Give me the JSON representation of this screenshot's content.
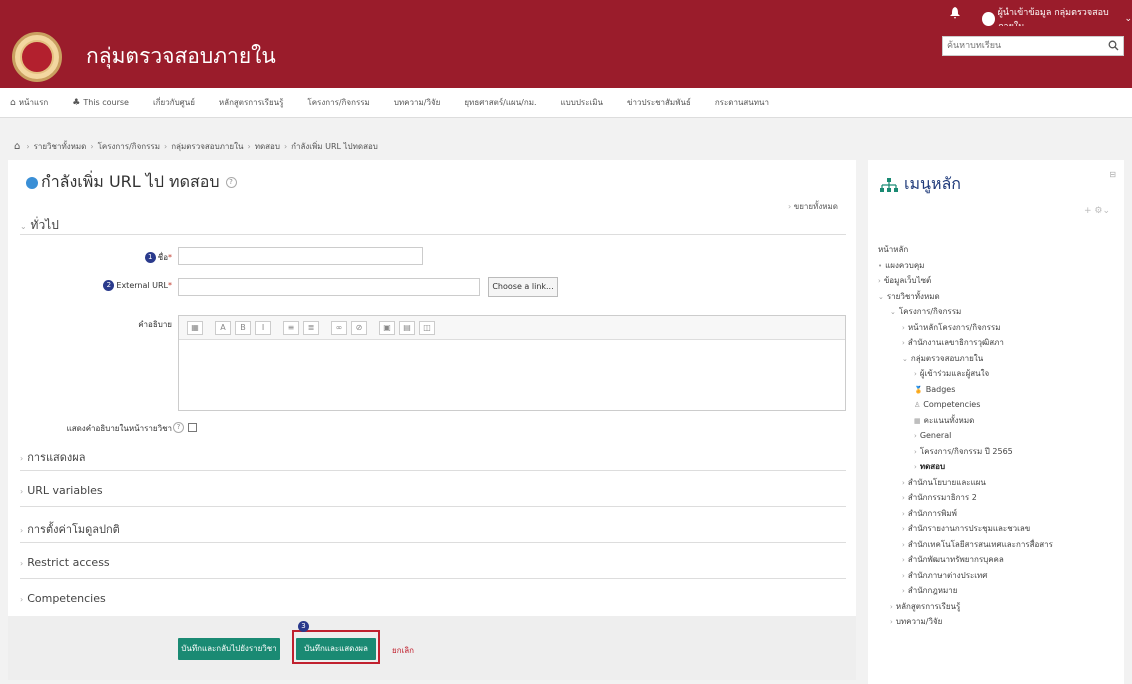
{
  "topbar": {
    "user_name": "ผู้นำเข้าข้อมูล กลุ่มตรวจสอบภายใน"
  },
  "header": {
    "site_title": "กลุ่มตรวจสอบภายใน",
    "search_placeholder": "ค้นหาบทเรียน"
  },
  "nav": {
    "items": [
      {
        "icon": "home-icon",
        "label": "หน้าแรก"
      },
      {
        "icon": "sitemap-icon",
        "label": "This course"
      },
      {
        "label": "เกี่ยวกับศูนย์"
      },
      {
        "label": "หลักสูตรการเรียนรู้"
      },
      {
        "label": "โครงการ/กิจกรรม"
      },
      {
        "label": "บทความ/วิจัย"
      },
      {
        "label": "ยุทธศาสตร์/แผน/กม."
      },
      {
        "label": "แบบประเมิน"
      },
      {
        "label": "ข่าวประชาสัมพันธ์"
      },
      {
        "label": "กระดานสนทนา"
      }
    ]
  },
  "breadcrumb": [
    "รายวิชาทั้งหมด",
    "โครงการ/กิจกรรม",
    "กลุ่มตรวจสอบภายใน",
    "ทดสอบ",
    "กำลังเพิ่ม URL ไปทดสอบ"
  ],
  "main": {
    "page_title": "กำลังเพิ่ม URL ไป ทดสอบ",
    "expand_all": "ขยายทั้งหมด",
    "section_general": "ทั่วไป",
    "name_label": "ชื่อ",
    "name_badge": "1",
    "name_value": "",
    "url_label": "External URL",
    "url_badge": "2",
    "url_value": "",
    "choose_link": "Choose a link...",
    "description_label": "คำอธิบาย",
    "show_desc_label": "แสดงคำอธิบายในหน้ารายวิชา",
    "sections_collapsed": [
      "การแสดงผล",
      "URL variables",
      "การตั้งค่าโมดูลปกติ",
      "Restrict access",
      "Competencies"
    ],
    "btn_save_return": "บันทึกและกลับไปยังรายวิชา",
    "btn_save_display": "บันทึกและแสดงผล",
    "btn_cancel": "ยกเลิก",
    "badge3": "3"
  },
  "block": {
    "title": "เมนูหลัก",
    "tree": [
      {
        "label": "หน้าหลัก",
        "level": 0,
        "arrow": ""
      },
      {
        "label": "แผงควบคุม",
        "level": 0,
        "arrow": "•"
      },
      {
        "label": "ข้อมูลเว็บไซต์",
        "level": 0,
        "arrow": "›"
      },
      {
        "label": "รายวิชาทั้งหมด",
        "level": 0,
        "arrow": "⌄"
      },
      {
        "label": "โครงการ/กิจกรรม",
        "level": 1,
        "arrow": "⌄"
      },
      {
        "label": "หน้าหลักโครงการ/กิจกรรม",
        "level": 2,
        "arrow": "›"
      },
      {
        "label": "สำนักงานเลขาธิการวุฒิสภา",
        "level": 2,
        "arrow": "›"
      },
      {
        "label": "กลุ่มตรวจสอบภายใน",
        "level": 2,
        "arrow": "⌄"
      },
      {
        "label": "ผู้เข้าร่วมและผู้สนใจ",
        "level": 3,
        "arrow": "›"
      },
      {
        "label": "Badges",
        "level": 3,
        "arrow": "🏅"
      },
      {
        "label": "Competencies",
        "level": 3,
        "arrow": "♙"
      },
      {
        "label": "คะแนนทั้งหมด",
        "level": 3,
        "arrow": "▦"
      },
      {
        "label": "General",
        "level": 3,
        "arrow": "›"
      },
      {
        "label": "โครงการ/กิจกรรม ปี 2565",
        "level": 3,
        "arrow": "›"
      },
      {
        "label": "ทดสอบ",
        "level": 3,
        "arrow": "›",
        "bold": true
      },
      {
        "label": "สำนักนโยบายและแผน",
        "level": 2,
        "arrow": "›"
      },
      {
        "label": "สำนักกรรมาธิการ 2",
        "level": 2,
        "arrow": "›"
      },
      {
        "label": "สำนักการพิมพ์",
        "level": 2,
        "arrow": "›"
      },
      {
        "label": "สำนักรายงานการประชุมและชวเลข",
        "level": 2,
        "arrow": "›"
      },
      {
        "label": "สำนักเทคโนโลยีสารสนเทศและการสื่อสาร",
        "level": 2,
        "arrow": "›"
      },
      {
        "label": "สำนักพัฒนาทรัพยากรบุคคล",
        "level": 2,
        "arrow": "›"
      },
      {
        "label": "สำนักภาษาต่างประเทศ",
        "level": 2,
        "arrow": "›"
      },
      {
        "label": "สำนักกฎหมาย",
        "level": 2,
        "arrow": "›"
      },
      {
        "label": "หลักสูตรการเรียนรู้",
        "level": 1,
        "arrow": "›"
      },
      {
        "label": "บทความ/วิจัย",
        "level": 1,
        "arrow": "›"
      }
    ]
  }
}
